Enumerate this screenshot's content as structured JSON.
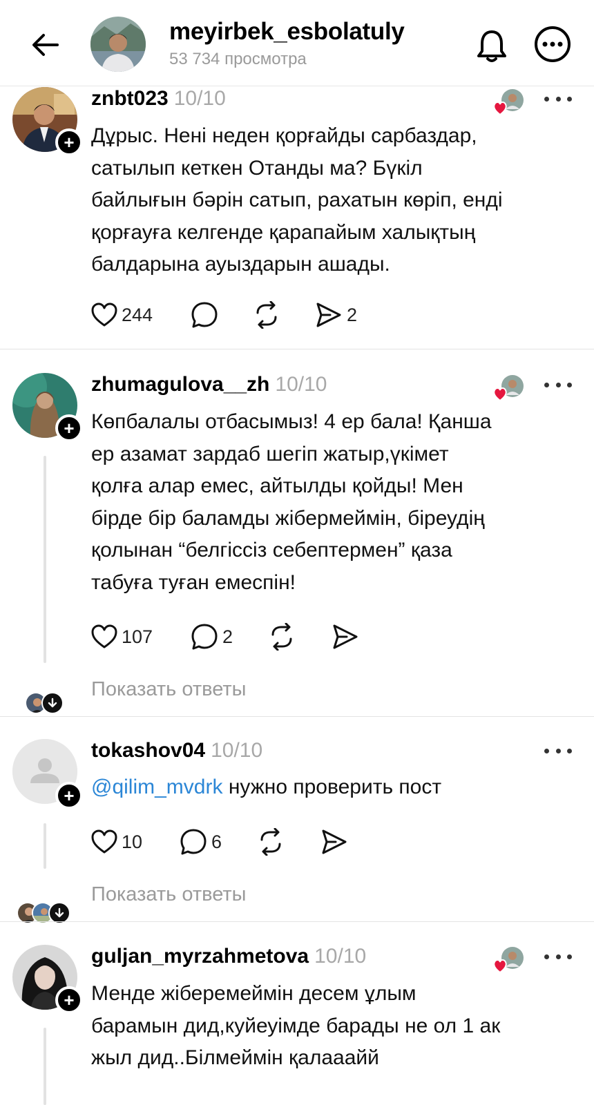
{
  "header": {
    "username": "meyirbek_esbolatuly",
    "views": "53 734 просмотра"
  },
  "show_replies_label": "Показать ответы",
  "comments": [
    {
      "username": "znbt023",
      "date": "10/10",
      "text_lines": [
        "Дұрыс. Нені неден қорғайды сарбаздар,",
        "сатылып кеткен Отанды ма? Бүкіл",
        "байлығын бәрін сатып, рахатын көріп, енді",
        "қорғауға келгенде қарапайым халықтың",
        "балдарына ауыздарын ашады."
      ],
      "likes": "244",
      "replies": "",
      "shares": "2",
      "liked_by_author": true
    },
    {
      "username": "zhumagulova__zh",
      "date": "10/10",
      "text_lines": [
        "Көпбалалы отбасымыз! 4 ер бала! Қанша",
        "ер азамат зардаб шегіп жатыр,үкімет",
        "қолға алар емес, айтылды қойды! Мен",
        "бірде бір баламды жібермеймін, біреудің",
        "қолынан “белгіссіз себептермен” қаза",
        "табуға туған емеспін!"
      ],
      "likes": "107",
      "replies": "2",
      "shares": "",
      "liked_by_author": true
    },
    {
      "username": "tokashov04",
      "date": "10/10",
      "mention": "@qilim_mvdrk",
      "text_after_mention": " нужно проверить пост",
      "likes": "10",
      "replies": "6",
      "shares": "",
      "liked_by_author": false
    },
    {
      "username": "guljan_myrzahmetova",
      "date": "10/10",
      "text_lines": [
        "Менде жіберемеймін десем ұлым",
        "барамын дид,куйеуімде барады не ол 1 ак",
        "жыл дид..Білмеймін қалааайй"
      ],
      "liked_by_author": true
    }
  ],
  "colors": {
    "accent_link": "#2b86d6",
    "heart_red": "#e5173f",
    "muted": "#9a9a9a"
  },
  "icons": [
    "back-arrow-icon",
    "bell-icon",
    "more-icon",
    "heart-icon",
    "comment-icon",
    "repost-icon",
    "share-icon",
    "chevron-down-icon",
    "plus-icon"
  ]
}
